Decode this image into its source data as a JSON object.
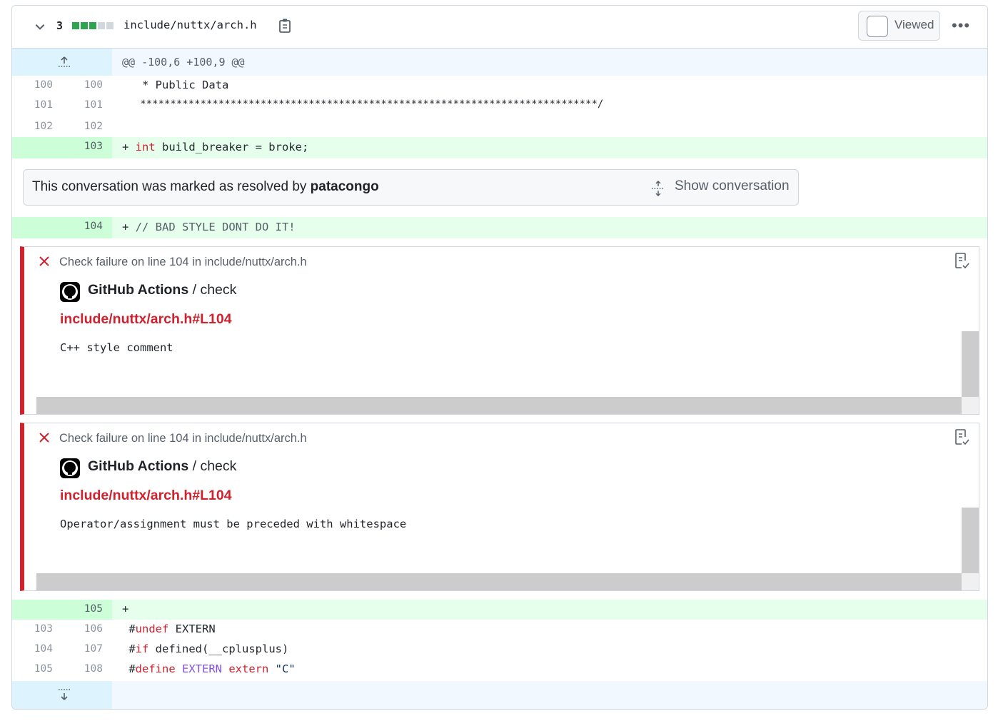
{
  "file": {
    "change_count": "3",
    "name": "include/nuttx/arch.h",
    "viewed_label": "Viewed"
  },
  "colors": {
    "diffstat_added": "#2da44e",
    "diffstat_neutral": "#d0d7de",
    "error": "#cf222e",
    "added_bg": "#e6ffec",
    "added_gutter_bg": "#ccffd8",
    "hunk_bg": "#f1f8ff"
  },
  "diffstat": [
    "added",
    "added",
    "added",
    "neutral",
    "neutral"
  ],
  "hunk": {
    "header": "@@ -100,6 +100,9 @@"
  },
  "lines_top": [
    {
      "old": "100",
      "new": "100",
      "code": "   * Public Data"
    },
    {
      "old": "101",
      "new": "101",
      "code": "   ****************************************************************************/"
    },
    {
      "old": "102",
      "new": "102",
      "code": ""
    }
  ],
  "added_103": {
    "new": "103",
    "prefix": "+ ",
    "kw": "int",
    "rest": " build_breaker = broke;"
  },
  "resolved": {
    "text": "This conversation was marked as resolved by",
    "user": "patacongo",
    "show_label": "Show conversation"
  },
  "added_104": {
    "new": "104",
    "prefix": "+ ",
    "comment": "// BAD STYLE DONT DO IT!"
  },
  "annotations": [
    {
      "title": "Check failure on line 104 in include/nuttx/arch.h",
      "app": "GitHub Actions",
      "sep_check": " / check",
      "link": "include/nuttx/arch.h#L104",
      "message": "C++ style comment"
    },
    {
      "title": "Check failure on line 104 in include/nuttx/arch.h",
      "app": "GitHub Actions",
      "sep_check": " / check",
      "link": "include/nuttx/arch.h#L104",
      "message": "Operator/assignment must be preceded with whitespace"
    }
  ],
  "added_105": {
    "new": "105",
    "prefix": "+"
  },
  "lines_bottom": [
    {
      "old": "103",
      "new": "106",
      "hash": " #",
      "kw": "undef",
      "rest": " EXTERN"
    },
    {
      "old": "104",
      "new": "107",
      "hash": " #",
      "kw": "if",
      "rest": " defined(__cplusplus)"
    },
    {
      "old": "105",
      "new": "108",
      "hash": " #",
      "kw": "define",
      "macro": " EXTERN",
      "kw2": " extern",
      "str": " \"C\""
    }
  ]
}
